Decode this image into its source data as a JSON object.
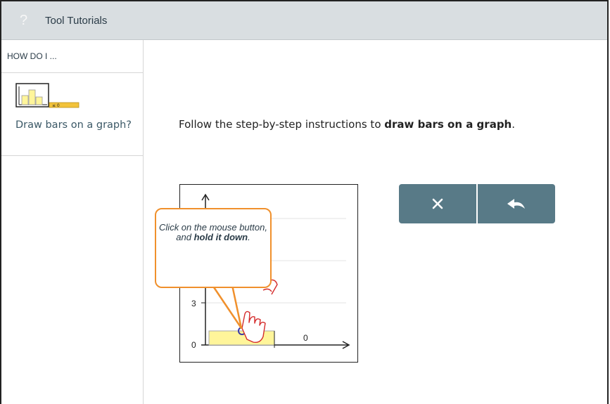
{
  "window": {
    "title": "Tool Tutorials",
    "help_icon": "question-mark-icon"
  },
  "sidebar": {
    "header": "HOW DO I ...",
    "items": [
      {
        "label": "Draw bars on a graph?",
        "icon": "bar-graph-tool-icon"
      }
    ]
  },
  "main": {
    "instruction_prefix": "Follow the step-by-step instructions to ",
    "instruction_emphasis": "draw bars on a graph",
    "instruction_suffix": ".",
    "callout_line1": "Click on the mouse button,",
    "callout_line2": "and ",
    "callout_bold": "hold it down",
    "callout_end": ".",
    "graph_label_3": "3",
    "graph_label_0": "0",
    "bar_value_label": "0",
    "buttons": [
      {
        "icon": "close-icon"
      },
      {
        "icon": "undo-icon"
      }
    ]
  },
  "colors": {
    "titlebar": "#d9dee1",
    "button": "#587a87",
    "callout_border": "#f0902c",
    "bar_fill": "#fff59a"
  }
}
